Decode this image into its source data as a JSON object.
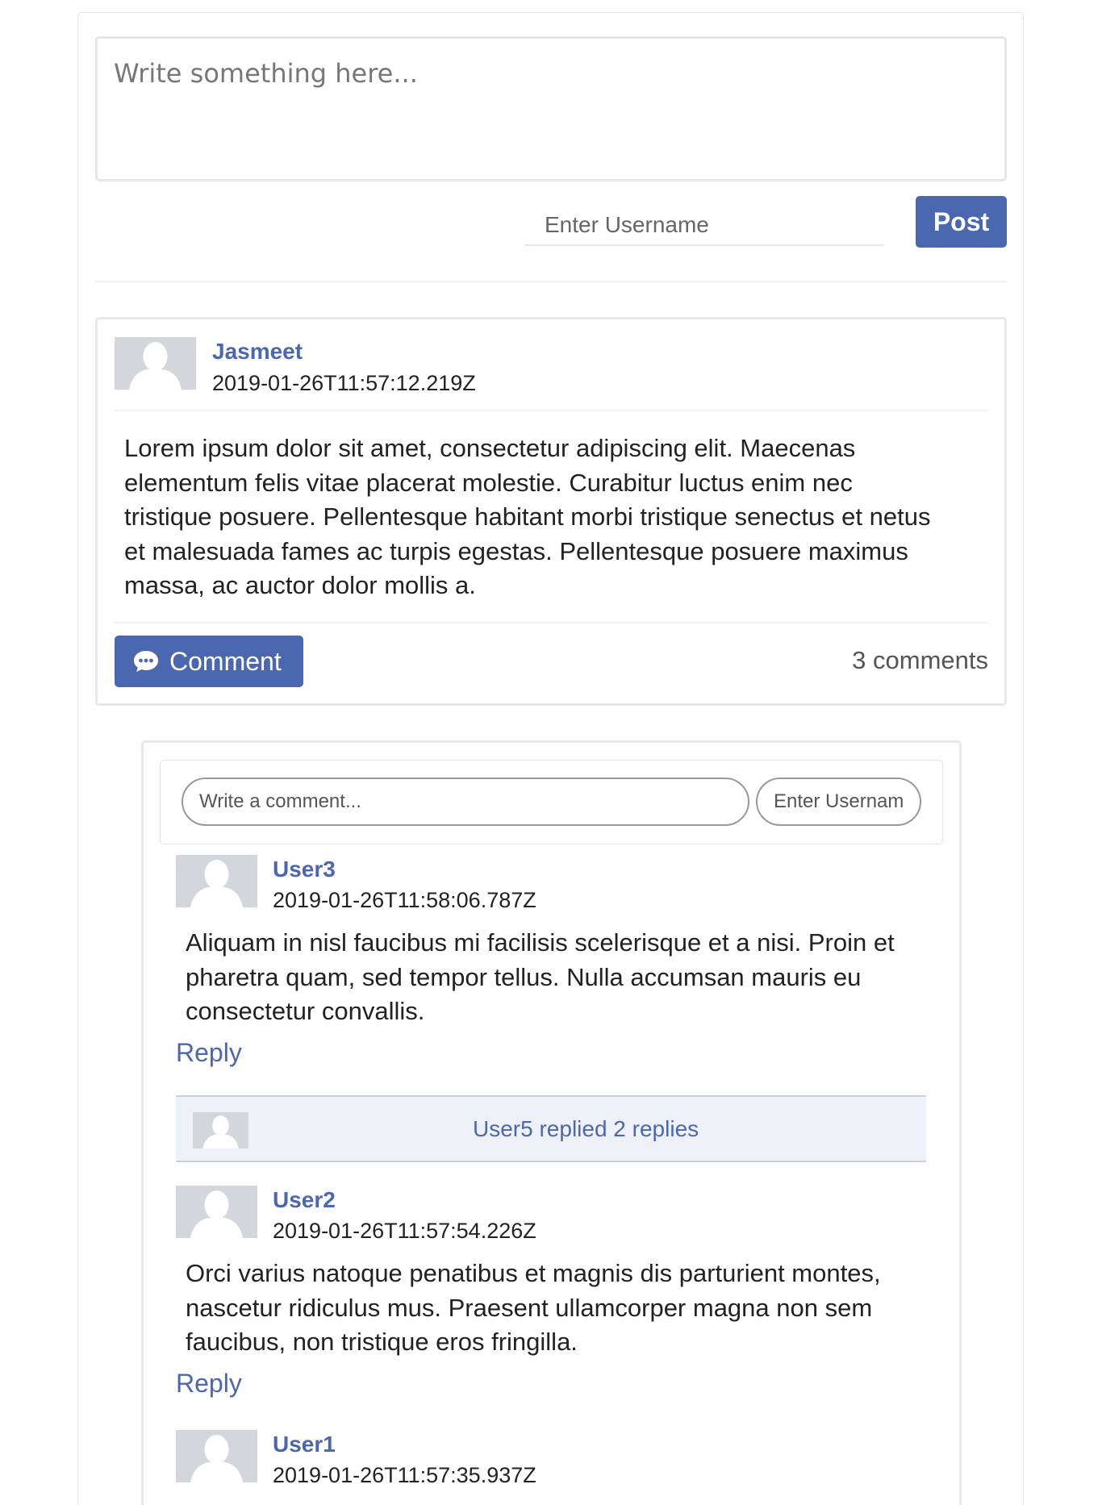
{
  "composer": {
    "placeholder": "Write something here...",
    "username_placeholder": "Enter Username",
    "post_label": "Post"
  },
  "post": {
    "author": "Jasmeet",
    "timestamp": "2019-01-26T11:57:12.219Z",
    "body": "Lorem ipsum dolor sit amet, consectetur adipiscing elit. Maecenas elementum felis vitae placerat molestie. Curabitur luctus enim nec tristique posuere. Pellentesque habitant morbi tristique senectus et netus et malesuada fames ac turpis egestas. Pellentesque posuere maximus massa, ac auctor dolor mollis a.",
    "comment_button": "Comment",
    "comments_count": "3 comments"
  },
  "comment_form": {
    "comment_placeholder": "Write a comment...",
    "username_placeholder": "Enter Username"
  },
  "comments": [
    {
      "author": "User3",
      "timestamp": "2019-01-26T11:58:06.787Z",
      "body": "Aliquam in nisl faucibus mi facilisis scelerisque et a nisi. Proin et pharetra quam, sed tempor tellus. Nulla accumsan mauris eu consectetur convallis.",
      "reply_label": "Reply",
      "replies_summary": "User5 replied 2 replies"
    },
    {
      "author": "User2",
      "timestamp": "2019-01-26T11:57:54.226Z",
      "body": "Orci varius natoque penatibus et magnis dis parturient montes, nascetur ridiculus mus. Praesent ullamcorper magna non sem faucibus, non tristique eros fringilla.",
      "reply_label": "Reply"
    },
    {
      "author": "User1",
      "timestamp": "2019-01-26T11:57:35.937Z"
    }
  ],
  "colors": {
    "accent": "#4b67b0",
    "avatar_bg": "#d3d6db",
    "border": "#e8e8e8"
  },
  "icons": {
    "avatar": "person-silhouette-icon",
    "comment": "speech-bubble-icon"
  }
}
